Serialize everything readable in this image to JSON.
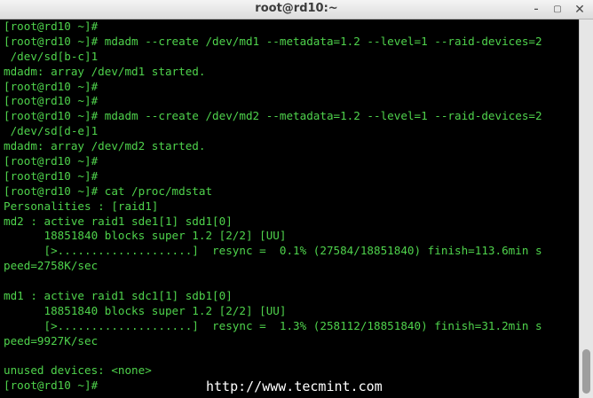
{
  "window": {
    "title": "root@rd10:~",
    "minimize_icon": "–",
    "maximize_icon": "▢",
    "close_icon": "✕"
  },
  "terminal": {
    "text_color": "#4fd34c",
    "background": "#000000",
    "lines": [
      "[root@rd10 ~]#",
      "[root@rd10 ~]# mdadm --create /dev/md1 --metadata=1.2 --level=1 --raid-devices=2",
      " /dev/sd[b-c]1",
      "mdadm: array /dev/md1 started.",
      "[root@rd10 ~]#",
      "[root@rd10 ~]#",
      "[root@rd10 ~]# mdadm --create /dev/md2 --metadata=1.2 --level=1 --raid-devices=2",
      " /dev/sd[d-e]1",
      "mdadm: array /dev/md2 started.",
      "[root@rd10 ~]#",
      "[root@rd10 ~]#",
      "[root@rd10 ~]# cat /proc/mdstat",
      "Personalities : [raid1]",
      "md2 : active raid1 sde1[1] sdd1[0]",
      "      18851840 blocks super 1.2 [2/2] [UU]",
      "      [>....................]  resync =  0.1% (27584/18851840) finish=113.6min s",
      "peed=2758K/sec",
      "",
      "md1 : active raid1 sdc1[1] sdb1[0]",
      "      18851840 blocks super 1.2 [2/2] [UU]",
      "      [>....................]  resync =  1.3% (258112/18851840) finish=31.2min s",
      "peed=9927K/sec",
      "",
      "unused devices: <none>",
      "[root@rd10 ~]#"
    ]
  },
  "watermark": "http://www.tecmint.com"
}
